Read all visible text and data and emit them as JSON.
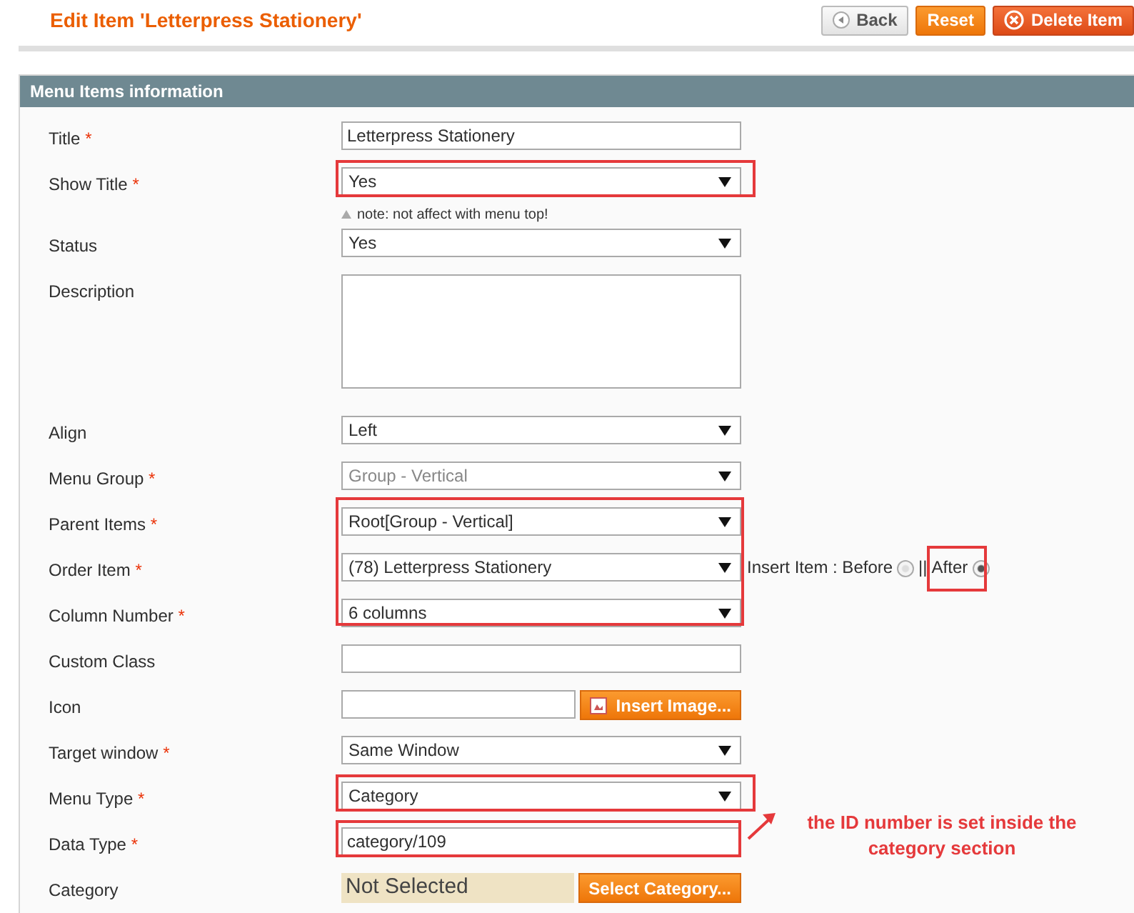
{
  "page_title": "Edit Item 'Letterpress Stationery'",
  "buttons": [
    {
      "label": "Back",
      "kind": "back"
    },
    {
      "label": "Reset",
      "kind": "reset"
    },
    {
      "label": "Delete Item",
      "kind": "delete"
    }
  ],
  "panel": {
    "title": "Menu Items information",
    "fields": [
      {
        "kind": "text",
        "label": "Title",
        "mark": "*",
        "value": "Letterpress Stationery"
      },
      {
        "kind": "select",
        "label": "Show Title",
        "mark": "*",
        "value": "Yes",
        "highlighted": true,
        "disabled": false,
        "note": "note: not affect with menu top!"
      },
      {
        "kind": "select",
        "label": "Status",
        "value": "Yes",
        "disabled": false
      },
      {
        "kind": "textarea",
        "label": "Description"
      },
      {
        "kind": "select",
        "label": "Align",
        "value": "Left",
        "disabled": false
      },
      {
        "kind": "select",
        "label": "Menu Group",
        "mark": "*",
        "value": "Group - Vertical",
        "disabled": true
      },
      {
        "kind": "group",
        "highlighted": true,
        "children": [
          {
            "kind": "select",
            "label": "Parent Items",
            "mark": "*",
            "value": "Root[Group - Vertical]",
            "disabled": false
          },
          {
            "kind": "select",
            "label": "Order Item",
            "mark": "*",
            "value": "(78) Letterpress Stationery",
            "disabled": false,
            "insert": {
              "label": "Insert Item : Before",
              "separator": "||",
              "after_label": "After",
              "after_selected": true,
              "after_highlighted": true
            }
          },
          {
            "kind": "select",
            "label": "Column Number",
            "mark": "*",
            "value": "6 columns",
            "disabled": false
          }
        ]
      },
      {
        "kind": "text",
        "label": "Custom Class"
      },
      {
        "kind": "image",
        "label": "Icon",
        "button": "Insert Image..."
      },
      {
        "kind": "select",
        "label": "Target window",
        "mark": "*",
        "value": "Same Window",
        "disabled": false
      },
      {
        "kind": "select",
        "label": "Menu Type",
        "mark": "*",
        "value": "Category",
        "highlighted": true,
        "disabled": false
      },
      {
        "kind": "text",
        "label": "Data Type",
        "mark": "*",
        "value": "category/109",
        "highlighted": true,
        "annotation": "the  ID number is set inside the category section"
      },
      {
        "kind": "category",
        "label": "Category",
        "value": "Not Selected",
        "button": "Select Category..."
      }
    ]
  }
}
